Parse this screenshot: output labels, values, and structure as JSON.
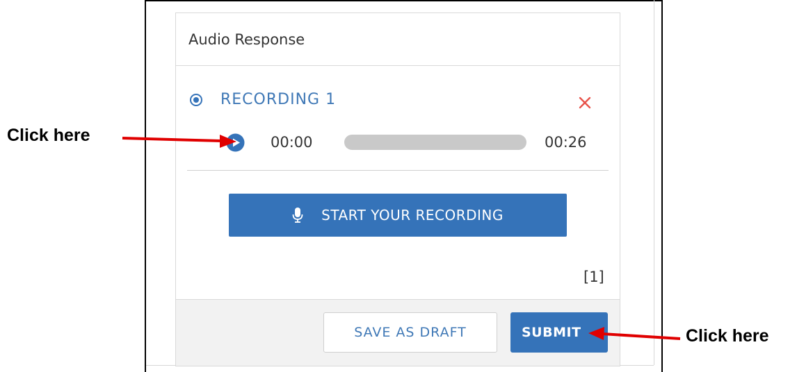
{
  "panel": {
    "title": "Audio Response"
  },
  "recording": {
    "label": "RECORDING 1",
    "time_current": "00:00",
    "time_total": "00:26",
    "progress": 0
  },
  "actions": {
    "start_label": "START YOUR RECORDING",
    "count": "[1]",
    "save_draft_label": "SAVE AS DRAFT",
    "submit_label": "SUBMIT"
  },
  "annotations": {
    "left_callout": "Click here",
    "right_callout": "Click here"
  },
  "colors": {
    "primary": "#3573b9",
    "link_text": "#3f78b6",
    "delete": "#e8534a",
    "arrow": "#e00000"
  },
  "icons": {
    "radio": "radio-selected-icon",
    "delete": "close-icon",
    "play": "play-icon",
    "mic": "microphone-icon"
  }
}
